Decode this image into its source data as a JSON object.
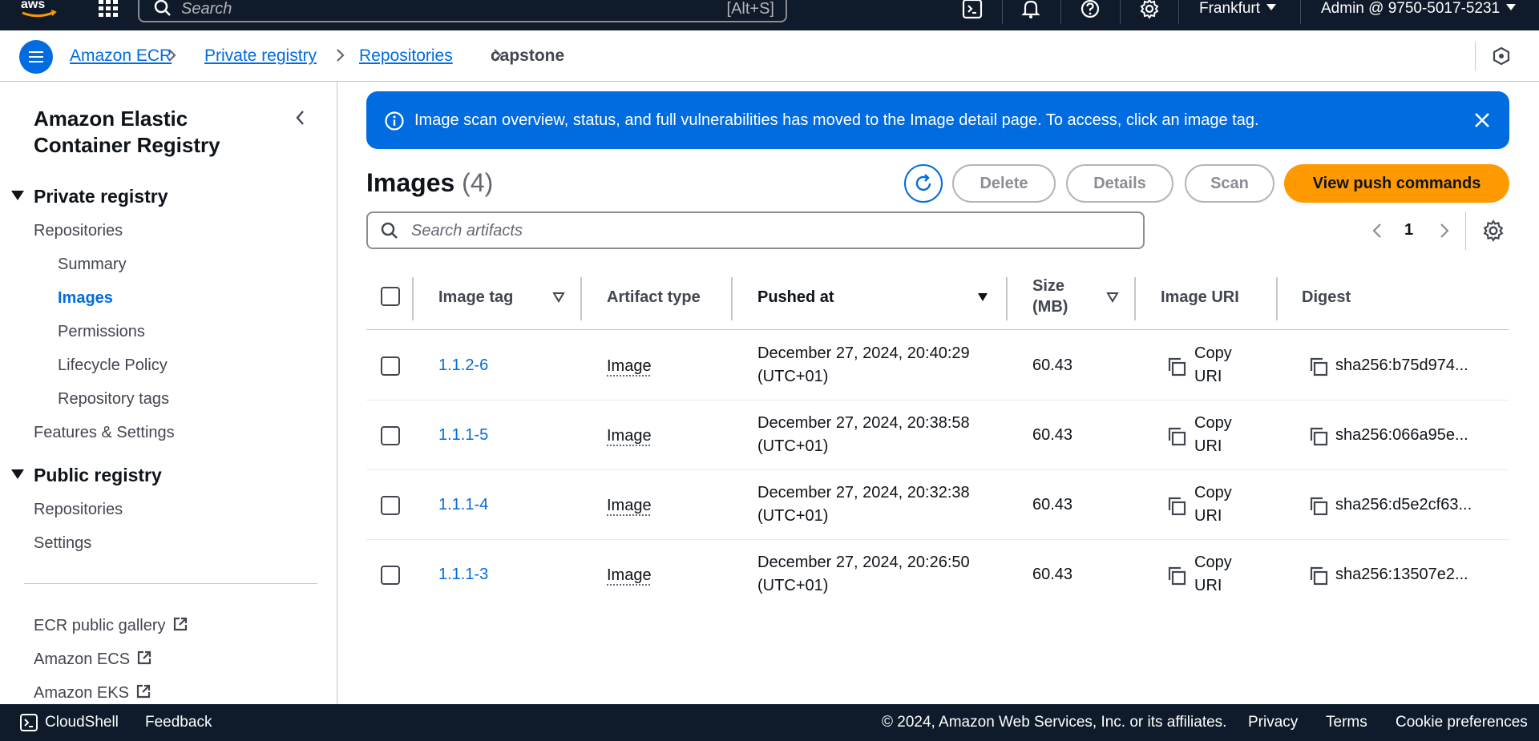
{
  "topnav": {
    "search_placeholder": "Search",
    "search_hint": "[Alt+S]",
    "region": "Frankfurt",
    "account": "Admin @ 9750-5017-5231"
  },
  "breadcrumb": {
    "items": [
      "Amazon ECR",
      "Private registry",
      "Repositories",
      "capstone"
    ]
  },
  "sidebar": {
    "title": "Amazon Elastic Container Registry",
    "private_section": "Private registry",
    "private_items": [
      "Repositories",
      "Summary",
      "Images",
      "Permissions",
      "Lifecycle Policy",
      "Repository tags",
      "Features & Settings"
    ],
    "public_section": "Public registry",
    "public_items": [
      "Repositories",
      "Settings"
    ],
    "external_links": [
      "ECR public gallery",
      "Amazon ECS",
      "Amazon EKS"
    ],
    "active_item": "Images"
  },
  "flash": {
    "message": "Image scan overview, status, and full vulnerabilities has moved to the Image detail page. To access, click an image tag."
  },
  "header": {
    "title": "Images",
    "count": "(4)",
    "buttons": {
      "delete": "Delete",
      "details": "Details",
      "scan": "Scan",
      "push": "View push commands"
    }
  },
  "filter": {
    "placeholder": "Search artifacts"
  },
  "pagination": {
    "current_page": "1"
  },
  "table": {
    "columns": [
      "Image tag",
      "Artifact type",
      "Pushed at",
      "Size (MB)",
      "Image URI",
      "Digest"
    ],
    "size_header_lines": [
      "Size",
      "(MB)"
    ],
    "rows": [
      {
        "tag": "1.1.2-6",
        "type": "Image",
        "pushed_date": "December 27, 2024, 20:40:29",
        "pushed_tz": "(UTC+01)",
        "size": "60.43",
        "uri_line1": "Copy",
        "uri_line2": "URI",
        "digest": "sha256:b75d974..."
      },
      {
        "tag": "1.1.1-5",
        "type": "Image",
        "pushed_date": "December 27, 2024, 20:38:58",
        "pushed_tz": "(UTC+01)",
        "size": "60.43",
        "uri_line1": "Copy",
        "uri_line2": "URI",
        "digest": "sha256:066a95e..."
      },
      {
        "tag": "1.1.1-4",
        "type": "Image",
        "pushed_date": "December 27, 2024, 20:32:38",
        "pushed_tz": "(UTC+01)",
        "size": "60.43",
        "uri_line1": "Copy",
        "uri_line2": "URI",
        "digest": "sha256:d5e2cf63..."
      },
      {
        "tag": "1.1.1-3",
        "type": "Image",
        "pushed_date": "December 27, 2024, 20:26:50",
        "pushed_tz": "(UTC+01)",
        "size": "60.43",
        "uri_line1": "Copy",
        "uri_line2": "URI",
        "digest": "sha256:13507e2..."
      }
    ]
  },
  "footer": {
    "cloudshell": "CloudShell",
    "feedback": "Feedback",
    "copyright": "© 2024, Amazon Web Services, Inc. or its affiliates.",
    "privacy": "Privacy",
    "terms": "Terms",
    "cookies": "Cookie preferences"
  },
  "colors": {
    "nav_bg": "#0f1b2a",
    "accent_blue": "#006ce0",
    "primary_orange": "#ff9900",
    "text_dark": "#0f141a",
    "text_muted": "#424650",
    "border": "#c6c6cd"
  },
  "icons": [
    "aws-logo",
    "apps-grid-icon",
    "search-icon",
    "cloudshell-icon",
    "bell-icon",
    "help-icon",
    "gear-icon",
    "caret-down-icon",
    "menu-icon",
    "chevron-right-icon",
    "hexagon-icon",
    "chevron-left-icon",
    "external-link-icon",
    "info-icon",
    "close-icon",
    "refresh-icon",
    "sort-icon",
    "copy-icon"
  ]
}
